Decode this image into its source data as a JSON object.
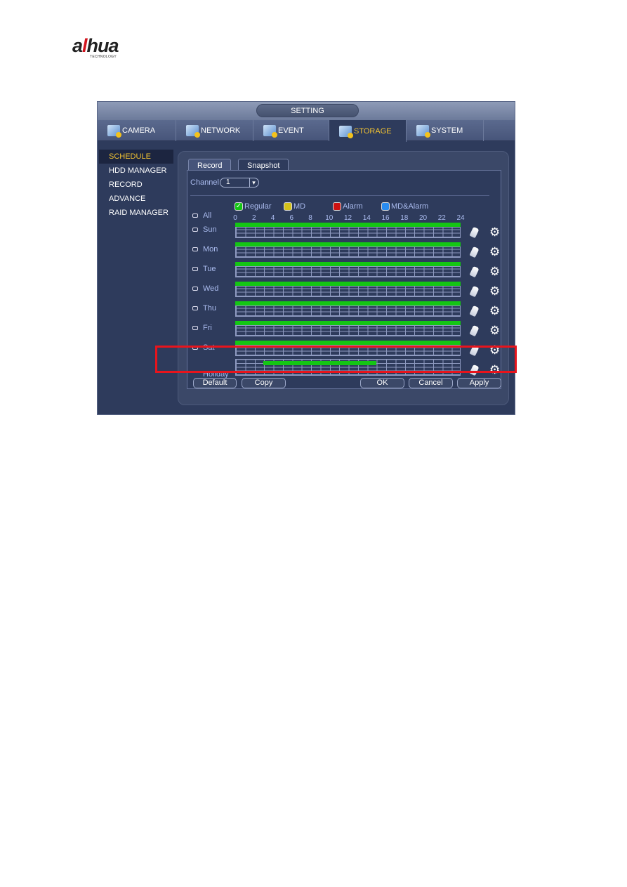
{
  "logo": {
    "brand": "alhua",
    "tagline": "TECHNOLOGY"
  },
  "window": {
    "title": "SETTING"
  },
  "tabs": [
    {
      "label": "CAMERA",
      "icon": "camera-icon"
    },
    {
      "label": "NETWORK",
      "icon": "network-icon"
    },
    {
      "label": "EVENT",
      "icon": "event-icon"
    },
    {
      "label": "STORAGE",
      "icon": "storage-icon",
      "active": true
    },
    {
      "label": "SYSTEM",
      "icon": "system-icon"
    }
  ],
  "sidebar": {
    "items": [
      {
        "label": "SCHEDULE",
        "active": true
      },
      {
        "label": "HDD MANAGER"
      },
      {
        "label": "RECORD"
      },
      {
        "label": "ADVANCE"
      },
      {
        "label": "RAID MANAGER"
      }
    ]
  },
  "panel": {
    "tabs": [
      {
        "label": "Record"
      },
      {
        "label": "Snapshot",
        "active": true
      }
    ],
    "channel_label": "Channel",
    "channel_value": "1",
    "legend": [
      {
        "label": "Regular",
        "color": "#14c614",
        "checked": true
      },
      {
        "label": "MD",
        "color": "#d4c21a"
      },
      {
        "label": "Alarm",
        "color": "#cc1111"
      },
      {
        "label": "MD&Alarm",
        "color": "#2a8cf0"
      }
    ],
    "all_label": "All",
    "hours": [
      "0",
      "2",
      "4",
      "6",
      "8",
      "10",
      "12",
      "14",
      "16",
      "18",
      "20",
      "22",
      "24"
    ],
    "rows": [
      {
        "label": "Sun",
        "regular": [
          0,
          24
        ]
      },
      {
        "label": "Mon",
        "regular": [
          0,
          24
        ]
      },
      {
        "label": "Tue",
        "regular": [
          0,
          24
        ]
      },
      {
        "label": "Wed",
        "regular": [
          0,
          24
        ]
      },
      {
        "label": "Thu",
        "regular": [
          0,
          24
        ]
      },
      {
        "label": "Fri",
        "regular": [
          0,
          24
        ]
      },
      {
        "label": "Sat",
        "regular": [
          0,
          24
        ]
      },
      {
        "label": "Holiday",
        "regular": [
          3,
          15
        ]
      }
    ],
    "buttons": {
      "default": "Default",
      "copy": "Copy",
      "ok": "OK",
      "cancel": "Cancel",
      "apply": "Apply"
    }
  },
  "highlight_color": "#e8141c"
}
